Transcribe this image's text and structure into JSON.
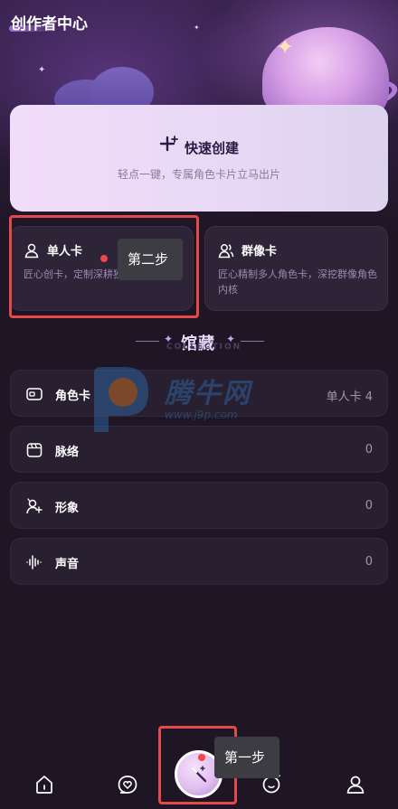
{
  "header": {
    "title": "创作者中心"
  },
  "quick_create": {
    "icon": "sparkle-plus-icon",
    "title": "快速创建",
    "subtitle": "轻点一键，专属角色卡片立马出片"
  },
  "cards": {
    "single": {
      "icon": "person-icon",
      "title": "单人卡",
      "desc": "匠心创卡，定制深耕独家角色档案"
    },
    "group": {
      "icon": "group-icon",
      "title": "群像卡",
      "desc": "匠心精制多人角色卡，深挖群像角色内核"
    }
  },
  "collection": {
    "title": "馆藏",
    "subtitle": "COLLECTION",
    "rows": [
      {
        "icon": "id-card-icon",
        "label": "角色卡",
        "value": "单人卡 4"
      },
      {
        "icon": "clapper-icon",
        "label": "脉络",
        "value": "0"
      },
      {
        "icon": "avatar-sparkle-icon",
        "label": "形象",
        "value": "0"
      },
      {
        "icon": "waveform-icon",
        "label": "声音",
        "value": "0"
      }
    ]
  },
  "tooltips": {
    "step1": "第一步",
    "step2": "第二步"
  },
  "watermark": {
    "text": "腾牛网",
    "url": "www.j9p.com"
  },
  "nav": {
    "items": [
      "home-icon",
      "heart-chat-icon",
      "magic-wand-icon",
      "planet-face-icon",
      "profile-icon"
    ]
  },
  "colors": {
    "highlight": "#e44a4a",
    "background": "#1e1624",
    "accent": "#9b6fd8"
  }
}
